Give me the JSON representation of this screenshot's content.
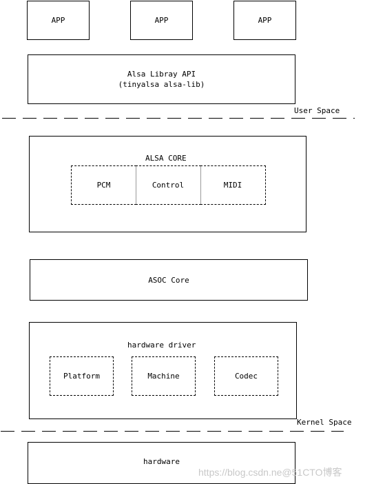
{
  "diagram": {
    "apps": [
      "APP",
      "APP",
      "APP"
    ],
    "alsa_lib": {
      "line1": "Alsa Libray API",
      "line2": "(tinyalsa alsa-lib)"
    },
    "user_space_label": "User Space",
    "alsa_core": {
      "title": "ALSA CORE",
      "modules": [
        "PCM",
        "Control",
        "MIDI"
      ]
    },
    "asoc_core": "ASOC Core",
    "hardware_driver": {
      "title": "hardware driver",
      "modules": [
        "Platform",
        "Machine",
        "Codec"
      ]
    },
    "kernel_space_label": "Kernel Space",
    "hardware": "hardware"
  },
  "watermark": "https://blog.csdn.ne@51CTO博客"
}
